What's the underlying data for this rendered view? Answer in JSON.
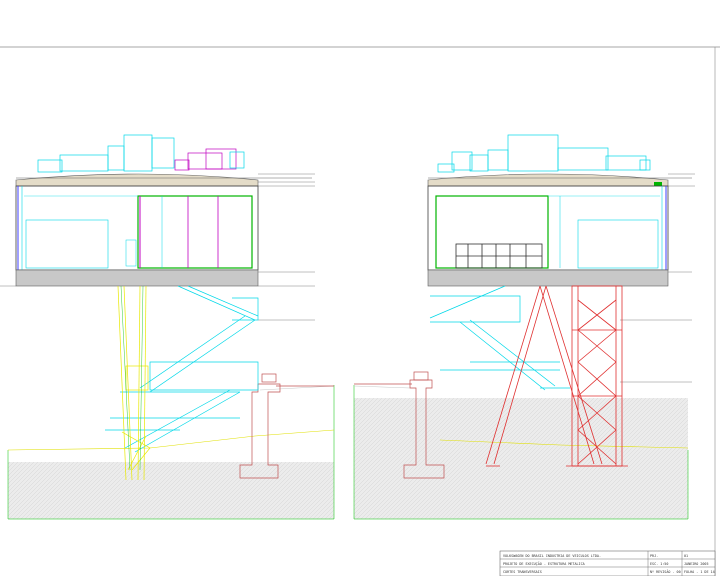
{
  "sheet": {
    "title_block": {
      "rows": [
        "VOLKSWAGEN DO BRASIL INDUSTRIA DE VEICULOS LTDA.",
        "PROJETO DE EXECUÇÃO - ESTRUTURA METALICA",
        "CORTES TRANSVERSAIS"
      ],
      "fields": {
        "label_1": "PRJ.",
        "value_1": "01",
        "label_2": "ESC. 1:50",
        "value_2": "JANEIRO 2005",
        "label_3": "Nº REVISÃO - 00",
        "value_3": "FOLHA - 1 DE 14"
      }
    }
  },
  "colors": {
    "background": "#ffffff",
    "structure_cyan": "#00d8e8",
    "glass_green": "#00b400",
    "magenta": "#c000c0",
    "steel_red": "#e03030",
    "yellow": "#e8e800",
    "concrete_red": "#c05050",
    "ground_hatch": "#e0e0e0",
    "slab_grey": "#c8c8c8",
    "line_dark": "#606060",
    "frame_line": "#808080"
  },
  "icons": [
    "section-left",
    "section-right"
  ]
}
